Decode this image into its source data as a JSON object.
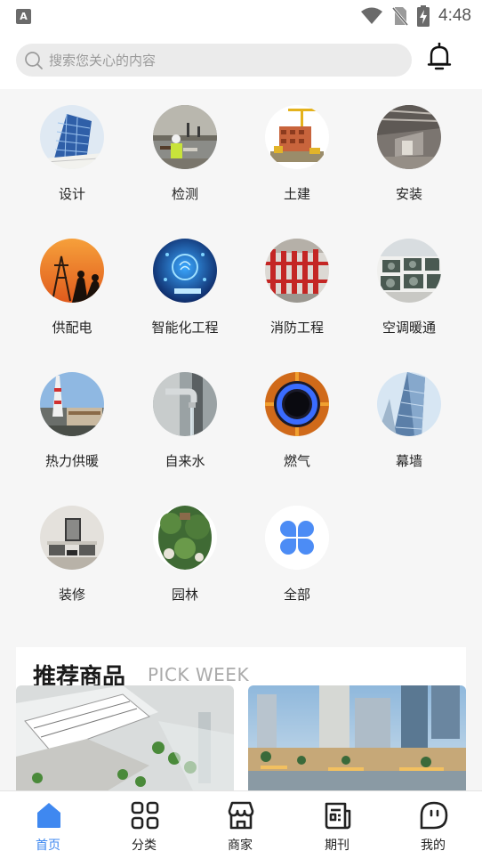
{
  "status_bar": {
    "time": "4:48",
    "app_icon_letter": "A"
  },
  "search": {
    "placeholder": "搜索您关心的内容"
  },
  "categories": [
    {
      "label": "设计",
      "icon": "design-building-icon"
    },
    {
      "label": "检测",
      "icon": "inspection-icon"
    },
    {
      "label": "土建",
      "icon": "civil-construction-icon"
    },
    {
      "label": "安装",
      "icon": "installation-icon"
    },
    {
      "label": "供配电",
      "icon": "power-supply-icon"
    },
    {
      "label": "智能化工程",
      "icon": "smart-engineering-icon"
    },
    {
      "label": "消防工程",
      "icon": "fire-protection-icon"
    },
    {
      "label": "空调暖通",
      "icon": "hvac-icon"
    },
    {
      "label": "热力供暖",
      "icon": "heating-icon"
    },
    {
      "label": "自来水",
      "icon": "water-tap-icon"
    },
    {
      "label": "燃气",
      "icon": "gas-flame-icon"
    },
    {
      "label": "幕墙",
      "icon": "curtain-wall-icon"
    },
    {
      "label": "装修",
      "icon": "decoration-icon"
    },
    {
      "label": "园林",
      "icon": "garden-icon"
    },
    {
      "label": "全部",
      "icon": "all-categories-icon"
    }
  ],
  "recommend": {
    "title": "推荐商品",
    "subtitle": "PICK WEEK"
  },
  "nav": [
    {
      "label": "首页",
      "icon": "home-icon",
      "active": true
    },
    {
      "label": "分类",
      "icon": "category-grid-icon",
      "active": false
    },
    {
      "label": "商家",
      "icon": "shop-icon",
      "active": false
    },
    {
      "label": "期刊",
      "icon": "journal-icon",
      "active": false
    },
    {
      "label": "我的",
      "icon": "profile-icon",
      "active": false
    }
  ],
  "colors": {
    "accent": "#3f88f0",
    "page_bg": "#f6f6f6",
    "search_bg": "#ebebeb"
  }
}
